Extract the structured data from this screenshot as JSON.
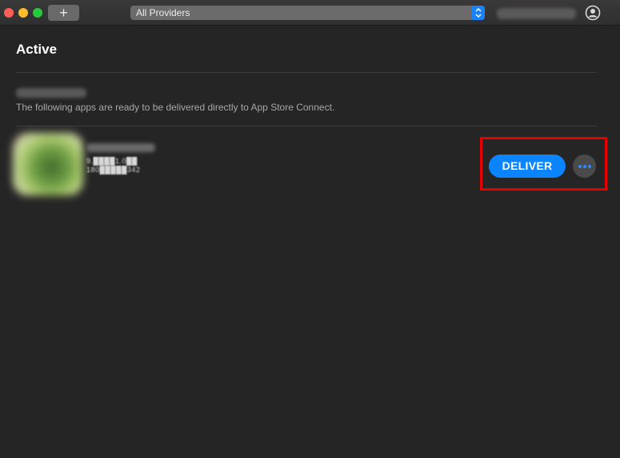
{
  "toolbar": {
    "add_label": "+",
    "provider_select": "All Providers",
    "account_icon": "person-circle-icon"
  },
  "main": {
    "heading": "Active",
    "group_description": "The following apps are ready to be delivered directly to App Store Connect.",
    "app": {
      "version": "9.████1.0██",
      "build": "180█████342",
      "deliver_label": "DELIVER",
      "more_icon": "ellipsis-icon"
    }
  },
  "colors": {
    "accent": "#0a84ff",
    "highlight": "#e60000",
    "background": "#262526"
  }
}
